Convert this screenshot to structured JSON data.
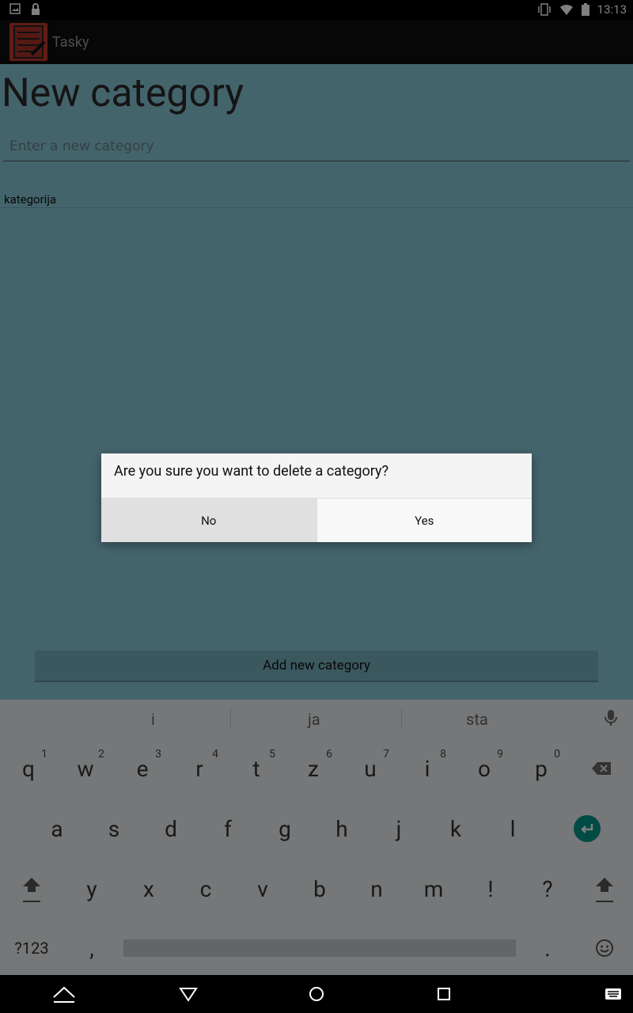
{
  "status": {
    "time": "13:13"
  },
  "app": {
    "title": "Tasky"
  },
  "page": {
    "title": "New category",
    "input_placeholder": "Enter a new category",
    "categories": [
      "kategorija"
    ],
    "add_button": "Add new category"
  },
  "dialog": {
    "message": "Are you sure you want to delete a category?",
    "no": "No",
    "yes": "Yes"
  },
  "keyboard": {
    "suggestions": [
      "i",
      "ja",
      "sta"
    ],
    "row1": [
      {
        "k": "q",
        "n": "1"
      },
      {
        "k": "w",
        "n": "2"
      },
      {
        "k": "e",
        "n": "3"
      },
      {
        "k": "r",
        "n": "4"
      },
      {
        "k": "t",
        "n": "5"
      },
      {
        "k": "z",
        "n": "6"
      },
      {
        "k": "u",
        "n": "7"
      },
      {
        "k": "i",
        "n": "8"
      },
      {
        "k": "o",
        "n": "9"
      },
      {
        "k": "p",
        "n": "0"
      }
    ],
    "row2": [
      "a",
      "s",
      "d",
      "f",
      "g",
      "h",
      "j",
      "k",
      "l"
    ],
    "row3": [
      "y",
      "x",
      "c",
      "v",
      "b",
      "n",
      "m",
      "!",
      "?"
    ],
    "symbols": "?123",
    "comma": ",",
    "period": "."
  },
  "colors": {
    "accent": "#009688",
    "content_bg": "#88c9d8"
  }
}
